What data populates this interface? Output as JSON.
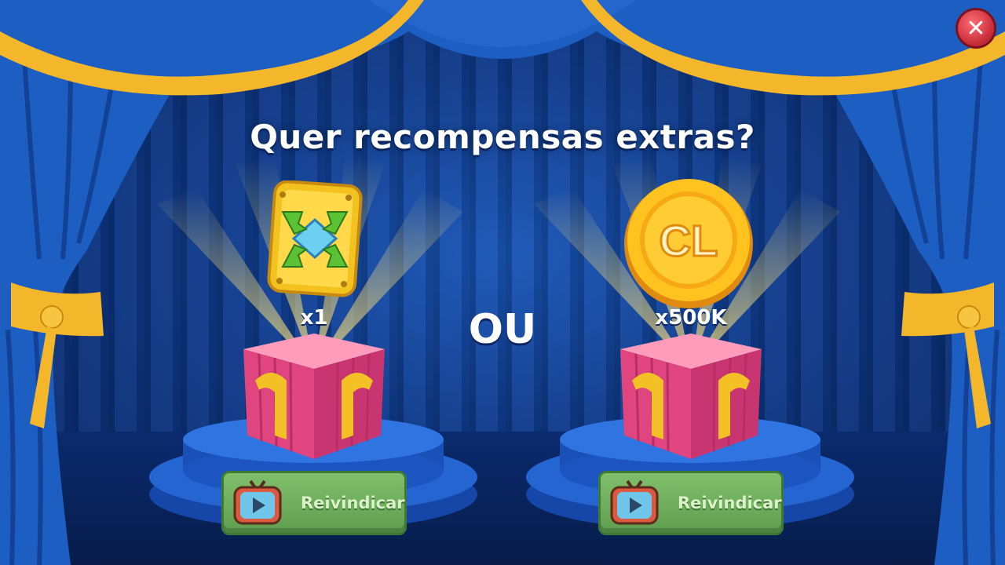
{
  "title": "Quer recompensas extras?",
  "separator": "OU",
  "rewards": [
    {
      "name": "tile-booster",
      "quantity": "x1",
      "claim_label": "Reivindicar"
    },
    {
      "name": "coin",
      "coin_letters": "CL",
      "quantity": "x500K",
      "claim_label": "Reivindicar"
    }
  ],
  "colors": {
    "curtain": "#1d5ec2",
    "curtain_trim": "#f4b62a",
    "gift": "#e0457f",
    "button": "#6aac58",
    "close_button": "#d8343f"
  },
  "icons": {
    "close": "close-icon",
    "claim": "tv-play-icon"
  }
}
